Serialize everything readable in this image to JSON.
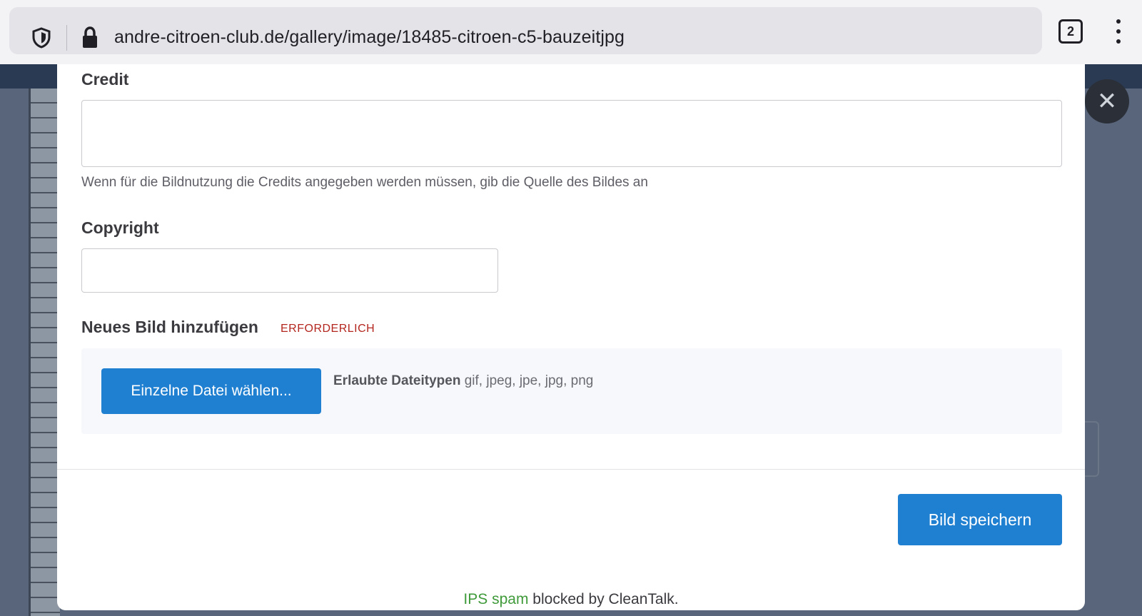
{
  "browser": {
    "url": "andre-citroen-club.de/gallery/image/18485-citroen-c5-bauzeitjpg",
    "tab_count": "2",
    "icons": {
      "shield": "shield-icon",
      "lock": "lock-icon",
      "menu": "kebab-menu-icon"
    }
  },
  "modal": {
    "close_icon": "close-icon",
    "credit": {
      "label": "Credit",
      "value": "",
      "hint": "Wenn für die Bildnutzung die Credits angegeben werden müssen, gib die Quelle des Bildes an"
    },
    "copyright": {
      "label": "Copyright",
      "value": ""
    },
    "upload": {
      "label": "Neues Bild hinzufügen",
      "required": "ERFORDERLICH",
      "button_label": "Einzelne Datei wählen...",
      "allowed_label": "Erlaubte Dateitypen",
      "allowed_types": "gif, jpeg, jpe, jpg, png"
    },
    "save_label": "Bild speichern",
    "footer": {
      "link_text": "IPS spam",
      "text": "blocked by CleanTalk."
    }
  },
  "colors": {
    "primary": "#1f7fd1",
    "required": "#b3261e",
    "link_green": "#3f9a3a"
  }
}
